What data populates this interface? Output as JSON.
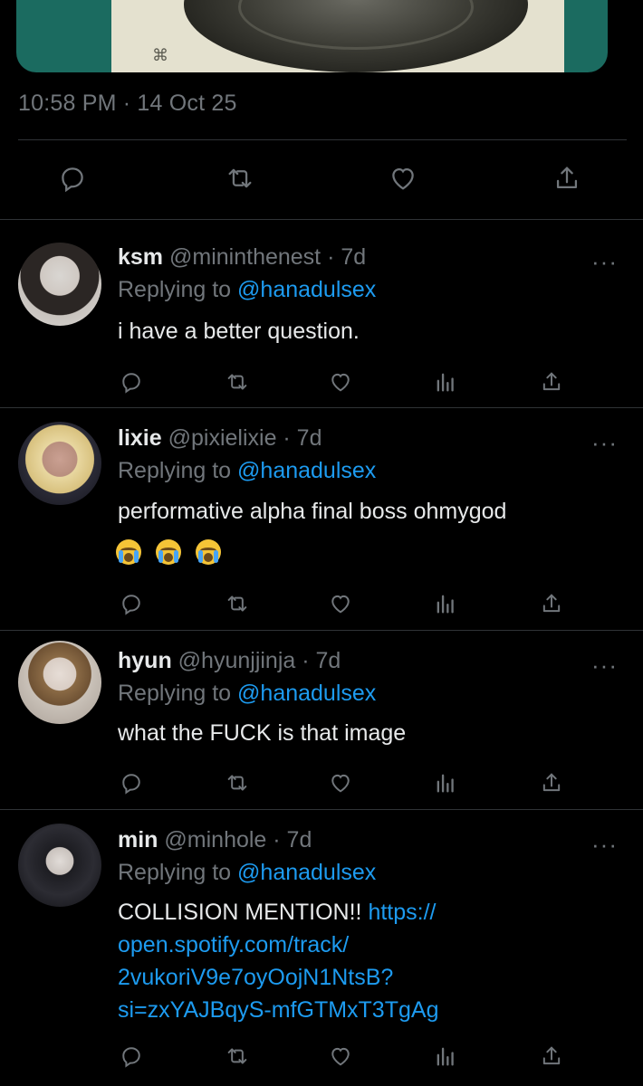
{
  "tweet": {
    "timestamp": "10:58 PM · 14 Oct 25",
    "actions": [
      "reply-icon",
      "retweet-icon",
      "like-icon",
      "share-icon"
    ]
  },
  "replies": [
    {
      "display_name": "ksm",
      "handle_time": "@mininthenest · 7d",
      "replying_prefix": "Replying to ",
      "replying_to": "@hanadulsex",
      "text": "i have a better question.",
      "more": "···"
    },
    {
      "display_name": "lixie",
      "handle_time": "@pixielixie · 7d",
      "replying_prefix": "Replying to ",
      "replying_to": "@hanadulsex",
      "text": "performative alpha final boss ohmygod",
      "emojis": "loudly-crying-face x3",
      "more": "···"
    },
    {
      "display_name": "hyun",
      "handle_time": "@hyunjjinja · 7d",
      "replying_prefix": "Replying to ",
      "replying_to": "@hanadulsex",
      "text": "what the FUCK is that image",
      "more": "···"
    },
    {
      "display_name": "min",
      "handle_time": "@minhole · 7d",
      "replying_prefix": "Replying to ",
      "replying_to": "@hanadulsex",
      "text": "COLLISION MENTION!! ",
      "link_line1": "https://",
      "link_line2": "open.spotify.com/track/",
      "link_line3": "2vukoriV9e7oyOojN1NtsB?",
      "link_line4": "si=zxYAJBqyS-mfGTMxT3TgAg",
      "more": "···"
    }
  ],
  "reply_actions": [
    "reply-icon",
    "retweet-icon",
    "like-icon",
    "analytics-icon",
    "share-icon"
  ],
  "colors": {
    "background": "#000000",
    "text": "#e7e9ea",
    "muted": "#71767b",
    "link": "#1d9bf0",
    "divider": "#2f3336"
  }
}
